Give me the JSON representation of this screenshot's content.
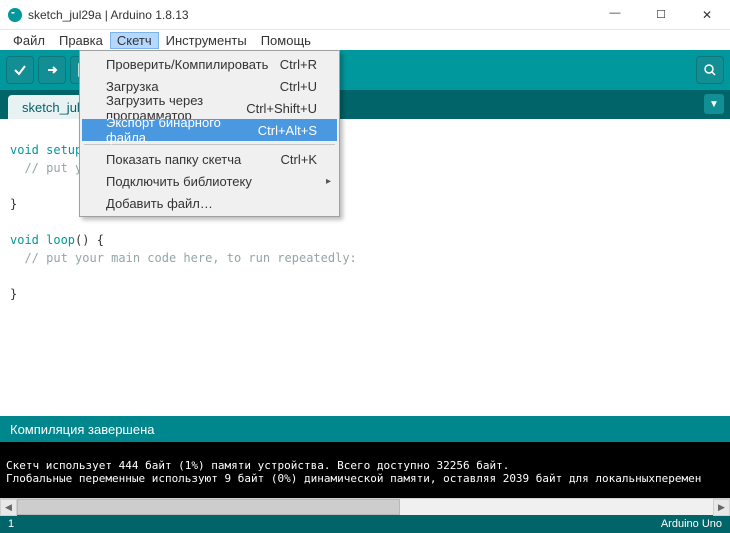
{
  "window": {
    "title": "sketch_jul29a | Arduino 1.8.13"
  },
  "menubar": {
    "items": [
      "Файл",
      "Правка",
      "Скетч",
      "Инструменты",
      "Помощь"
    ],
    "active_index": 2
  },
  "dropdown": {
    "items": [
      {
        "label": "Проверить/Компилировать",
        "shortcut": "Ctrl+R",
        "highlight": false,
        "separator_after": false,
        "submenu": false
      },
      {
        "label": "Загрузка",
        "shortcut": "Ctrl+U",
        "highlight": false,
        "separator_after": false,
        "submenu": false
      },
      {
        "label": "Загрузить через программатор",
        "shortcut": "Ctrl+Shift+U",
        "highlight": false,
        "separator_after": false,
        "submenu": false
      },
      {
        "label": "Экспорт бинарного файла",
        "shortcut": "Ctrl+Alt+S",
        "highlight": true,
        "separator_after": true,
        "submenu": false
      },
      {
        "label": "Показать папку скетча",
        "shortcut": "Ctrl+K",
        "highlight": false,
        "separator_after": false,
        "submenu": false
      },
      {
        "label": "Подключить библиотеку",
        "shortcut": "",
        "highlight": false,
        "separator_after": false,
        "submenu": true
      },
      {
        "label": "Добавить файл…",
        "shortcut": "",
        "highlight": false,
        "separator_after": false,
        "submenu": false
      }
    ]
  },
  "tabs": {
    "active": "sketch_jul29"
  },
  "code": {
    "l1a": "void",
    "l1b": " setup",
    "l1c": "(",
    "l2": "  // put yo",
    "l3": "",
    "l4": "}",
    "l5": "",
    "l6a": "void",
    "l6b": " loop",
    "l6c": "() {",
    "l7": "  // put your main code here, to run repeatedly:",
    "l8": "",
    "l9": "}"
  },
  "status": {
    "message": "Компиляция завершена"
  },
  "console": {
    "line1": "Скетч использует 444 байт (1%) памяти устройства. Всего доступно 32256 байт.",
    "line2": "Глобальные переменные используют 9 байт (0%) динамической памяти, оставляя 2039 байт для локальныхперемен"
  },
  "footer": {
    "line": "1",
    "board": "Arduino Uno"
  }
}
